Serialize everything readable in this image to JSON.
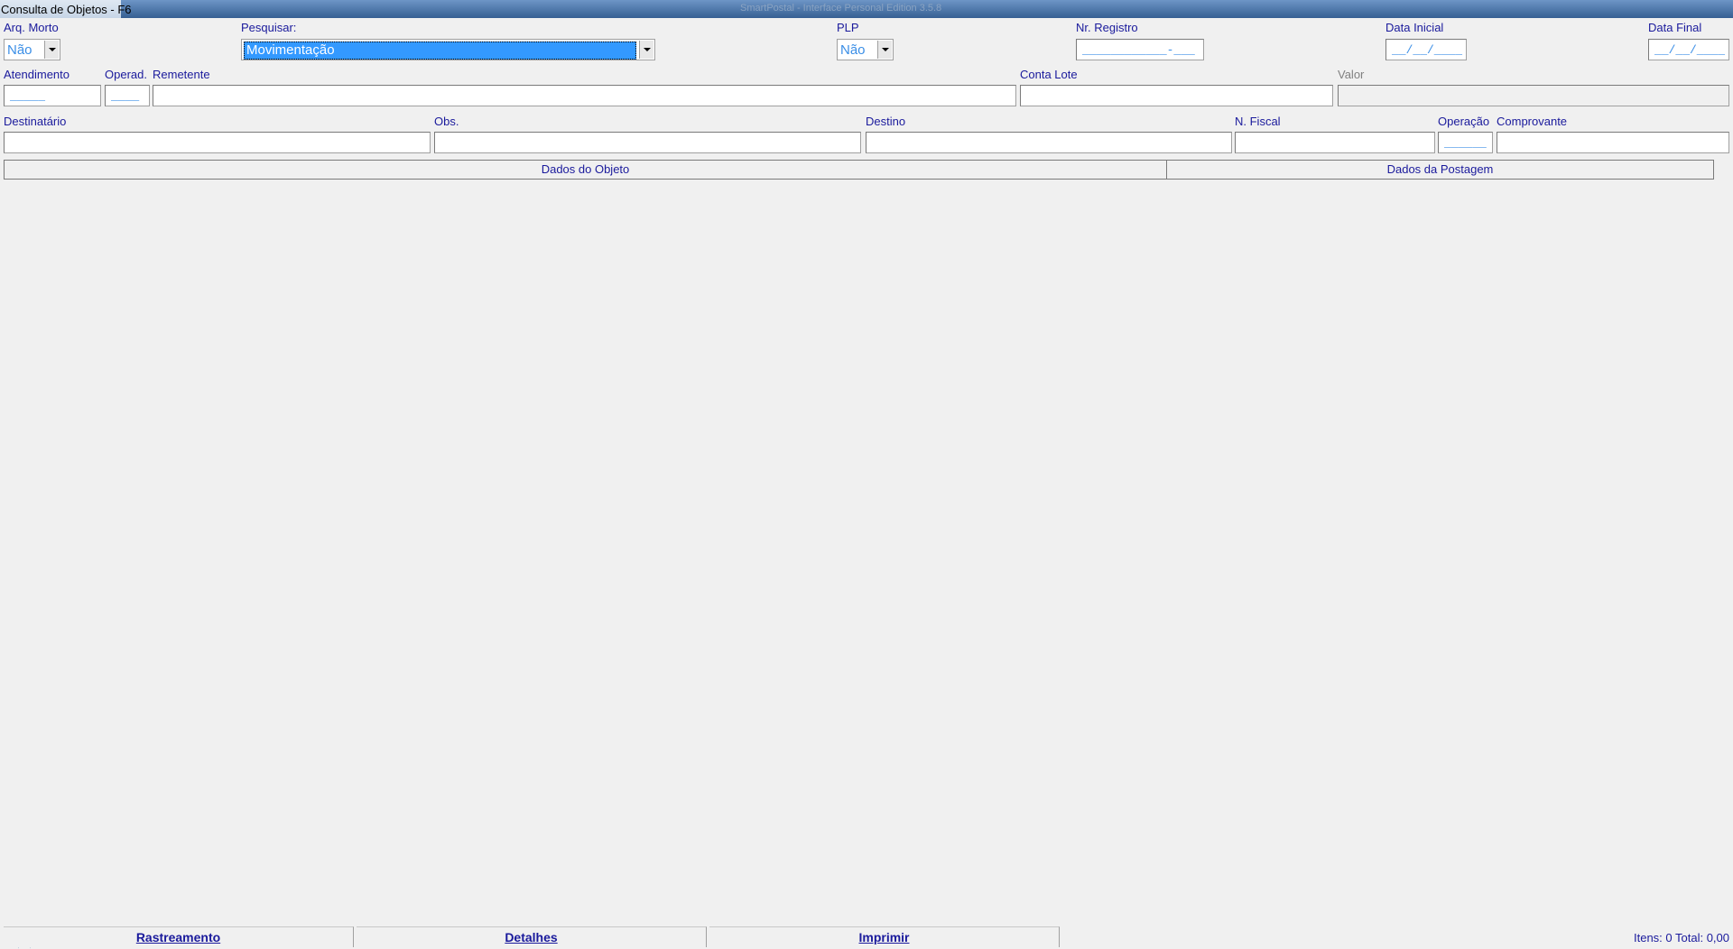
{
  "window": {
    "title": "Consulta de Objetos - F6",
    "bg_title": "SmartPostal - Interface Personal Edition 3.5.8"
  },
  "filters": {
    "arq_morto": {
      "label": "Arq. Morto",
      "value": "Não"
    },
    "pesquisar": {
      "label": "Pesquisar:",
      "value": "Movimentação"
    },
    "plp": {
      "label": "PLP",
      "value": "Não"
    },
    "nr_registro": {
      "label": "Nr. Registro",
      "mask": "____________-___"
    },
    "data_inicial": {
      "label": "Data Inicial",
      "mask": "__/__/____"
    },
    "data_final": {
      "label": "Data Final",
      "mask": "__/__/____"
    },
    "atendimento": {
      "label": "Atendimento",
      "mask": "_____"
    },
    "operad": {
      "label": "Operad.",
      "mask": "____"
    },
    "remetente": {
      "label": "Remetente",
      "value": ""
    },
    "conta_lote": {
      "label": "Conta Lote",
      "value": ""
    },
    "valor": {
      "label": "Valor",
      "value": ""
    },
    "destinatario": {
      "label": "Destinatário",
      "value": ""
    },
    "obs": {
      "label": "Obs.",
      "value": ""
    },
    "destino": {
      "label": "Destino",
      "value": ""
    },
    "n_fiscal": {
      "label": "N. Fiscal",
      "value": ""
    },
    "operacao": {
      "label": "Operação",
      "mask": "______"
    },
    "comprovante": {
      "label": "Comprovante",
      "value": ""
    }
  },
  "grid": {
    "headers": [
      "Dados do Objeto",
      "Dados da Postagem"
    ]
  },
  "footer": {
    "buttons": [
      "Rastreamento",
      "Detalhes",
      "Imprimir"
    ],
    "status": "Itens: 0 Total: 0,00"
  },
  "colors": {
    "label": "#1a1a9c",
    "mask": "#3a8ee6",
    "selection": "#3399ff"
  }
}
